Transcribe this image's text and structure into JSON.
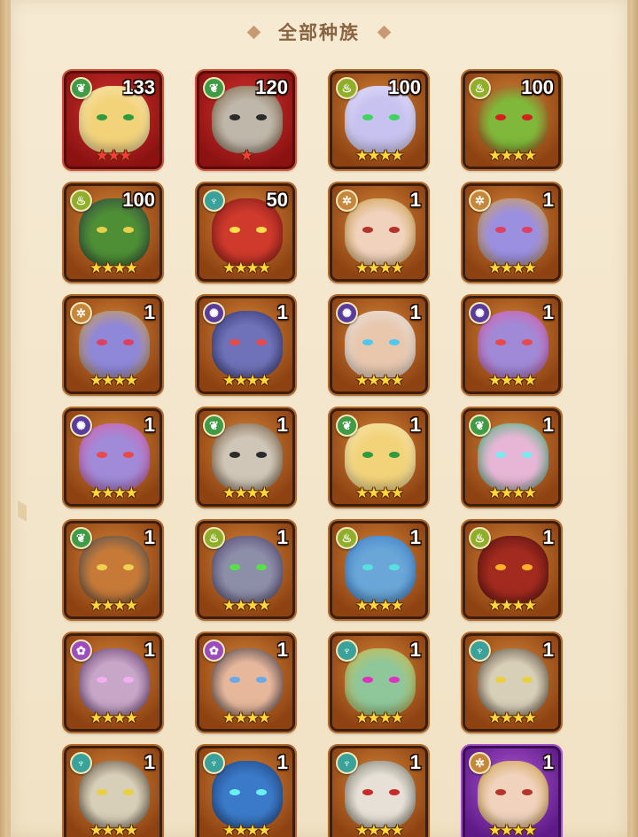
{
  "header": {
    "title": "全部种族"
  },
  "heroes": [
    {
      "count": "133",
      "faction": "forest",
      "faction_icon": "❦",
      "stars": "★★★",
      "star_color": "red",
      "frame": "red",
      "skin": "#f3d37a",
      "accent": "#f6e9b8",
      "eye": "#2f9a3e"
    },
    {
      "count": "120",
      "faction": "forest",
      "faction_icon": "❦",
      "stars": "★",
      "star_color": "red",
      "frame": "red",
      "skin": "#bfb7aa",
      "accent": "#7a5a3a",
      "eye": "#2b2b2b"
    },
    {
      "count": "100",
      "faction": "gold",
      "faction_icon": "♨",
      "stars": "★★★★",
      "star_color": "gold",
      "frame": "orange",
      "skin": "#c7c2ef",
      "accent": "#e8e6ff",
      "eye": "#3fd35f"
    },
    {
      "count": "100",
      "faction": "gold",
      "faction_icon": "♨",
      "stars": "★★★★",
      "star_color": "gold",
      "frame": "orange",
      "skin": "#7fb83a",
      "accent": "#d02a20",
      "eye": "#d61f1f"
    },
    {
      "count": "100",
      "faction": "gold",
      "faction_icon": "♨",
      "stars": "★★★★",
      "star_color": "gold",
      "frame": "orange",
      "skin": "#4e8f35",
      "accent": "#2f3a45",
      "eye": "#e8d04a"
    },
    {
      "count": "50",
      "faction": "nature",
      "faction_icon": "♆",
      "stars": "★★★★",
      "star_color": "gold",
      "frame": "orange",
      "skin": "#cf3a2c",
      "accent": "#7a1616",
      "eye": "#ffe04a"
    },
    {
      "count": "1",
      "faction": "fortress",
      "faction_icon": "✲",
      "stars": "★★★★",
      "star_color": "gold",
      "frame": "orange",
      "skin": "#f1d2bd",
      "accent": "#c79a3a",
      "eye": "#b4332b"
    },
    {
      "count": "1",
      "faction": "fortress",
      "faction_icon": "✲",
      "stars": "★★★★",
      "star_color": "gold",
      "frame": "orange",
      "skin": "#9b8fe0",
      "accent": "#e0a930",
      "eye": "#e04060"
    },
    {
      "count": "1",
      "faction": "fortress",
      "faction_icon": "✲",
      "stars": "★★★★",
      "star_color": "gold",
      "frame": "orange",
      "skin": "#8f87d8",
      "accent": "#e0a930",
      "eye": "#e04060"
    },
    {
      "count": "1",
      "faction": "dark",
      "faction_icon": "✺",
      "stars": "★★★★",
      "star_color": "gold",
      "frame": "orange",
      "skin": "#6f72b8",
      "accent": "#2c2f6a",
      "eye": "#e84a4a"
    },
    {
      "count": "1",
      "faction": "dark",
      "faction_icon": "✺",
      "stars": "★★★★",
      "star_color": "gold",
      "frame": "orange",
      "skin": "#e8c7ad",
      "accent": "#e9e9ea",
      "eye": "#4fc8f0"
    },
    {
      "count": "1",
      "faction": "dark",
      "faction_icon": "✺",
      "stars": "★★★★",
      "star_color": "gold",
      "frame": "orange",
      "skin": "#a08ad8",
      "accent": "#e45aa0",
      "eye": "#e84a4a"
    },
    {
      "count": "1",
      "faction": "dark",
      "faction_icon": "✺",
      "stars": "★★★★",
      "star_color": "gold",
      "frame": "orange",
      "skin": "#a18ad8",
      "accent": "#e45aa0",
      "eye": "#e84a4a"
    },
    {
      "count": "1",
      "faction": "forest",
      "faction_icon": "❦",
      "stars": "★★★★",
      "star_color": "gold",
      "frame": "orange",
      "skin": "#cfc6b7",
      "accent": "#6a4a2e",
      "eye": "#2b2b2b"
    },
    {
      "count": "1",
      "faction": "forest",
      "faction_icon": "❦",
      "stars": "★★★★",
      "star_color": "gold",
      "frame": "orange",
      "skin": "#f3d37a",
      "accent": "#f6e9b8",
      "eye": "#2f9a3e"
    },
    {
      "count": "1",
      "faction": "forest",
      "faction_icon": "❦",
      "stars": "★★★★",
      "star_color": "gold",
      "frame": "orange",
      "skin": "#e7b6d6",
      "accent": "#35b36a",
      "eye": "#7de8f0"
    },
    {
      "count": "1",
      "faction": "forest",
      "faction_icon": "❦",
      "stars": "★★★★",
      "star_color": "gold",
      "frame": "orange",
      "skin": "#c77a38",
      "accent": "#3a4a5a",
      "eye": "#f0d050"
    },
    {
      "count": "1",
      "faction": "gold",
      "faction_icon": "♨",
      "stars": "★★★★",
      "star_color": "gold",
      "frame": "orange",
      "skin": "#8d8ea8",
      "accent": "#4a3a6a",
      "eye": "#58e04a"
    },
    {
      "count": "1",
      "faction": "gold",
      "faction_icon": "♨",
      "stars": "★★★★",
      "star_color": "gold",
      "frame": "orange",
      "skin": "#6aa7d8",
      "accent": "#3a7ac8",
      "eye": "#58e0e0"
    },
    {
      "count": "1",
      "faction": "gold",
      "faction_icon": "♨",
      "stars": "★★★★",
      "star_color": "gold",
      "frame": "orange",
      "skin": "#a32a1e",
      "accent": "#4a1010",
      "eye": "#ffb02a"
    },
    {
      "count": "1",
      "faction": "light",
      "faction_icon": "✿",
      "stars": "★★★★",
      "star_color": "gold",
      "frame": "orange",
      "skin": "#c7a6c8",
      "accent": "#5a2f60",
      "eye": "#f0b0f0"
    },
    {
      "count": "1",
      "faction": "light",
      "faction_icon": "✿",
      "stars": "★★★★",
      "star_color": "gold",
      "frame": "orange",
      "skin": "#e6b79a",
      "accent": "#2e2a3e",
      "eye": "#6aa8e8"
    },
    {
      "count": "1",
      "faction": "nature",
      "faction_icon": "♆",
      "stars": "★★★★",
      "star_color": "gold",
      "frame": "orange",
      "skin": "#8fc79a",
      "accent": "#e0b83a",
      "eye": "#e030c0"
    },
    {
      "count": "1",
      "faction": "nature",
      "faction_icon": "♆",
      "stars": "★★★★",
      "star_color": "gold",
      "frame": "orange",
      "skin": "#d8cfb8",
      "accent": "#4a3a2a",
      "eye": "#e8d040"
    },
    {
      "count": "1",
      "faction": "nature",
      "faction_icon": "♆",
      "stars": "★★★★",
      "star_color": "gold",
      "frame": "orange",
      "skin": "#d8cfb8",
      "accent": "#4a3a2a",
      "eye": "#e8d040"
    },
    {
      "count": "1",
      "faction": "nature",
      "faction_icon": "♆",
      "stars": "★★★★",
      "star_color": "gold",
      "frame": "orange",
      "skin": "#3a7ac8",
      "accent": "#1f3f7a",
      "eye": "#6af0f0"
    },
    {
      "count": "1",
      "faction": "nature",
      "faction_icon": "♆",
      "stars": "★★★★",
      "star_color": "gold",
      "frame": "orange",
      "skin": "#e6e0d6",
      "accent": "#6a6a5a",
      "eye": "#c82a2a"
    },
    {
      "count": "1",
      "faction": "fortress",
      "faction_icon": "✲",
      "stars": "★★★★",
      "star_color": "gold",
      "frame": "purple",
      "skin": "#f1d2bd",
      "accent": "#c79a3a",
      "eye": "#b4332b"
    }
  ]
}
